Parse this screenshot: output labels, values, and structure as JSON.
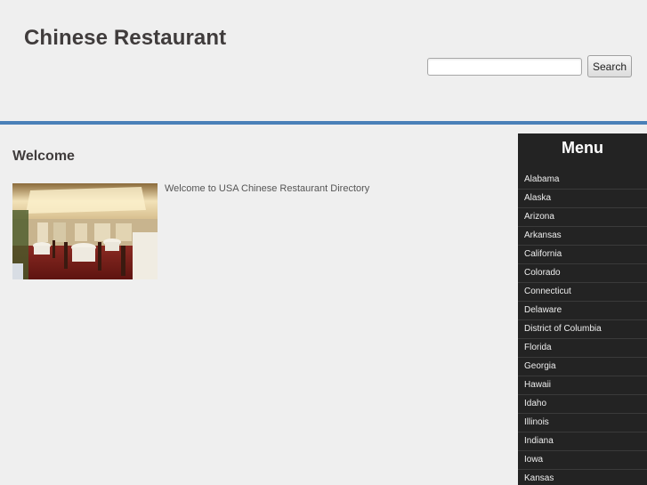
{
  "header": {
    "site_title": "Chinese Restaurant",
    "search": {
      "input_value": "",
      "button_label": "Search"
    },
    "rule_color": "#4a80b8"
  },
  "main": {
    "heading": "Welcome",
    "image_subject": "restaurant-dining-room-photo",
    "intro_text": "Welcome to USA Chinese Restaurant Directory"
  },
  "menu": {
    "title": "Menu",
    "items": [
      {
        "label": "Alabama"
      },
      {
        "label": "Alaska"
      },
      {
        "label": "Arizona"
      },
      {
        "label": "Arkansas"
      },
      {
        "label": "California"
      },
      {
        "label": "Colorado"
      },
      {
        "label": "Connecticut"
      },
      {
        "label": "Delaware"
      },
      {
        "label": "District of Columbia"
      },
      {
        "label": "Florida"
      },
      {
        "label": "Georgia"
      },
      {
        "label": "Hawaii"
      },
      {
        "label": "Idaho"
      },
      {
        "label": "Illinois"
      },
      {
        "label": "Indiana"
      },
      {
        "label": "Iowa"
      },
      {
        "label": "Kansas"
      }
    ]
  }
}
